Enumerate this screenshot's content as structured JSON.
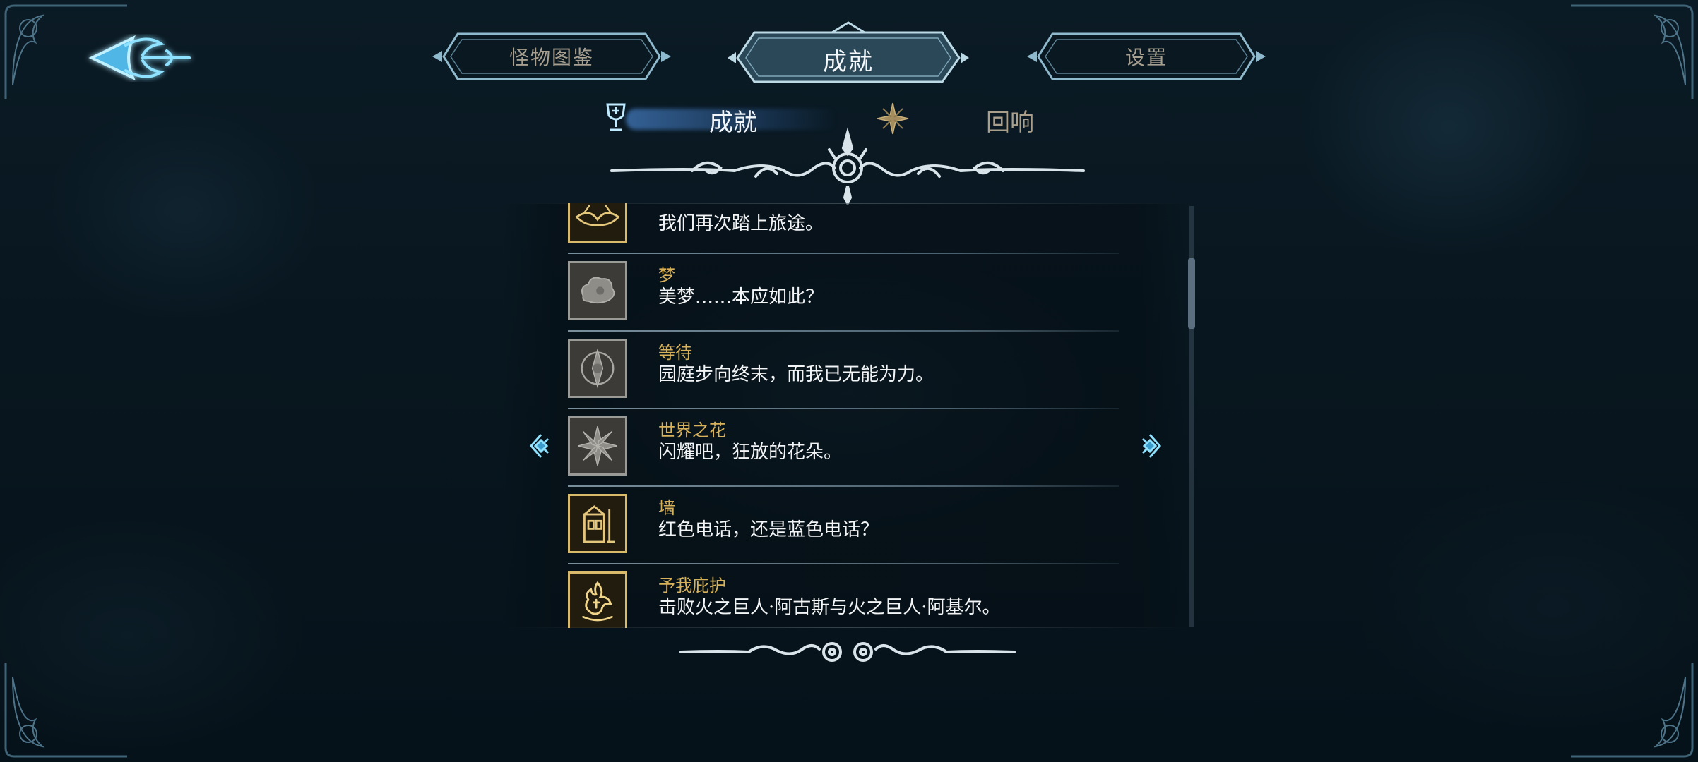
{
  "nav": {
    "back_label": "",
    "tabs": [
      {
        "label": "怪物图鉴",
        "active": false
      },
      {
        "label": "成就",
        "active": true
      },
      {
        "label": "设置",
        "active": false
      }
    ]
  },
  "subtabs": [
    {
      "label": "成就",
      "icon": "chalice-icon",
      "active": true
    },
    {
      "label": "回响",
      "icon": "star-flower-icon",
      "active": false
    }
  ],
  "achievements": [
    {
      "title": "",
      "desc": "我们再次踏上旅途。",
      "icon": "winged-emblem-icon",
      "unlocked": true
    },
    {
      "title": "梦",
      "desc": "美梦……本应如此？",
      "icon": "dream-cloud-icon",
      "unlocked": false
    },
    {
      "title": "等待",
      "desc": "园庭步向终末，而我已无能为力。",
      "icon": "waiting-sigil-icon",
      "unlocked": false
    },
    {
      "title": "世界之花",
      "desc": "闪耀吧，狂放的花朵。",
      "icon": "world-flower-icon",
      "unlocked": false
    },
    {
      "title": "墙",
      "desc": "红色电话，还是蓝色电话？",
      "icon": "phone-booth-icon",
      "unlocked": true
    },
    {
      "title": "予我庇护",
      "desc": "击败火之巨人·阿古斯与火之巨人·阿基尔。",
      "icon": "fire-giant-icon",
      "unlocked": true
    }
  ],
  "colors": {
    "accent": "#6fd3ff",
    "title_gold": "#d7b25a",
    "locked_frame": "#9a9a96",
    "gold_frame": "#d9b96a"
  },
  "list": {
    "scroll_position": 0.15
  }
}
